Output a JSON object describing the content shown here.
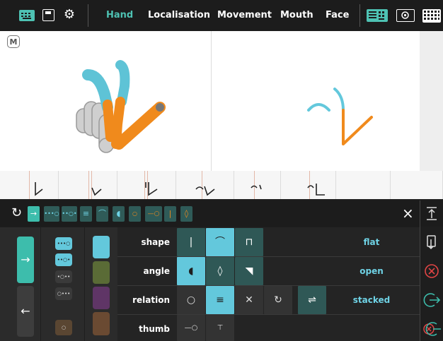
{
  "topbar": {
    "tabs": [
      {
        "label": "Hand",
        "active": true
      },
      {
        "label": "Localisation",
        "active": false
      },
      {
        "label": "Movement",
        "active": false
      },
      {
        "label": "Mouth",
        "active": false
      },
      {
        "label": "Face",
        "active": false
      }
    ],
    "left_icons": [
      "keyboard-icon",
      "save-icon",
      "settings-icon"
    ],
    "right_icons": [
      "keyboard-layout-icon",
      "target-icon",
      "grid-keyboard-icon"
    ]
  },
  "canvas": {
    "badge": "M"
  },
  "palette": {
    "close_glyph": "×",
    "refresh_glyph": "↻"
  },
  "rows": [
    {
      "label": "shape",
      "value": "flat"
    },
    {
      "label": "angle",
      "value": "open"
    },
    {
      "label": "relation",
      "value": "stacked"
    },
    {
      "label": "thumb",
      "value": ""
    }
  ],
  "colors": {
    "accent": "#3dbdac",
    "cyan": "#63c8dc",
    "orange": "#f08a1c",
    "swatches": [
      "#63c8dc",
      "#5a6b36",
      "#5f3566",
      "#6a4a32"
    ]
  }
}
